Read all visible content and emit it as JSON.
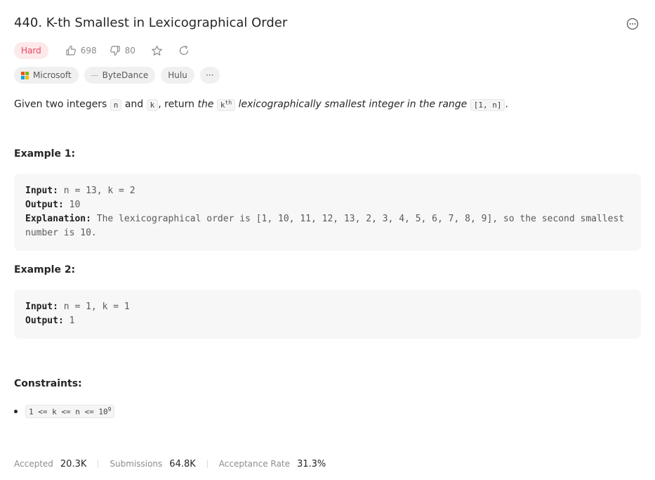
{
  "problem": {
    "title": "440. K-th Smallest in Lexicographical Order",
    "difficulty": "Hard",
    "likes": "698",
    "dislikes": "80"
  },
  "tags": [
    {
      "label": "Microsoft"
    },
    {
      "label": "ByteDance"
    },
    {
      "label": "Hulu"
    },
    {
      "label": "···"
    }
  ],
  "description": {
    "p1": "Given two integers ",
    "code_n": "n",
    "p2": " and ",
    "code_k": "k",
    "p3": ", return ",
    "em1": "the",
    "code_kth": "k",
    "kth_sup": "th",
    "em2": "lexicographically smallest integer in the range",
    "code_range": "[1, n]",
    "p4": "."
  },
  "examples": [
    {
      "heading": "Example 1:",
      "input_label": "Input:",
      "input_value": " n = 13, k = 2",
      "output_label": "Output:",
      "output_value": " 10",
      "explanation_label": "Explanation:",
      "explanation_value": " The lexicographical order is [1, 10, 11, 12, 13, 2, 3, 4, 5, 6, 7, 8, 9], so the second smallest number is 10."
    },
    {
      "heading": "Example 2:",
      "input_label": "Input:",
      "input_value": " n = 1, k = 1",
      "output_label": "Output:",
      "output_value": " 1"
    }
  ],
  "constraints": {
    "heading": "Constraints:",
    "items": [
      {
        "text": "1 <= k <= n <= 10",
        "sup": "9"
      }
    ]
  },
  "stats": {
    "accepted_label": "Accepted",
    "accepted_value": "20.3K",
    "submissions_label": "Submissions",
    "submissions_value": "64.8K",
    "rate_label": "Acceptance Rate",
    "rate_value": "31.3%"
  },
  "icons": {
    "like": "thumbs-up-icon",
    "dislike": "thumbs-down-icon",
    "favorite": "star-icon",
    "share": "refresh-share-icon",
    "more": "more-dots-icon",
    "microsoft": "microsoft-logo-icon",
    "bytedance": "bytedance-dash-icon"
  },
  "colors": {
    "hard_text": "#e8475c",
    "hard_bg": "#fde8ea",
    "code_bg": "#f7f7f8",
    "tag_bg": "#f0f0f0"
  }
}
